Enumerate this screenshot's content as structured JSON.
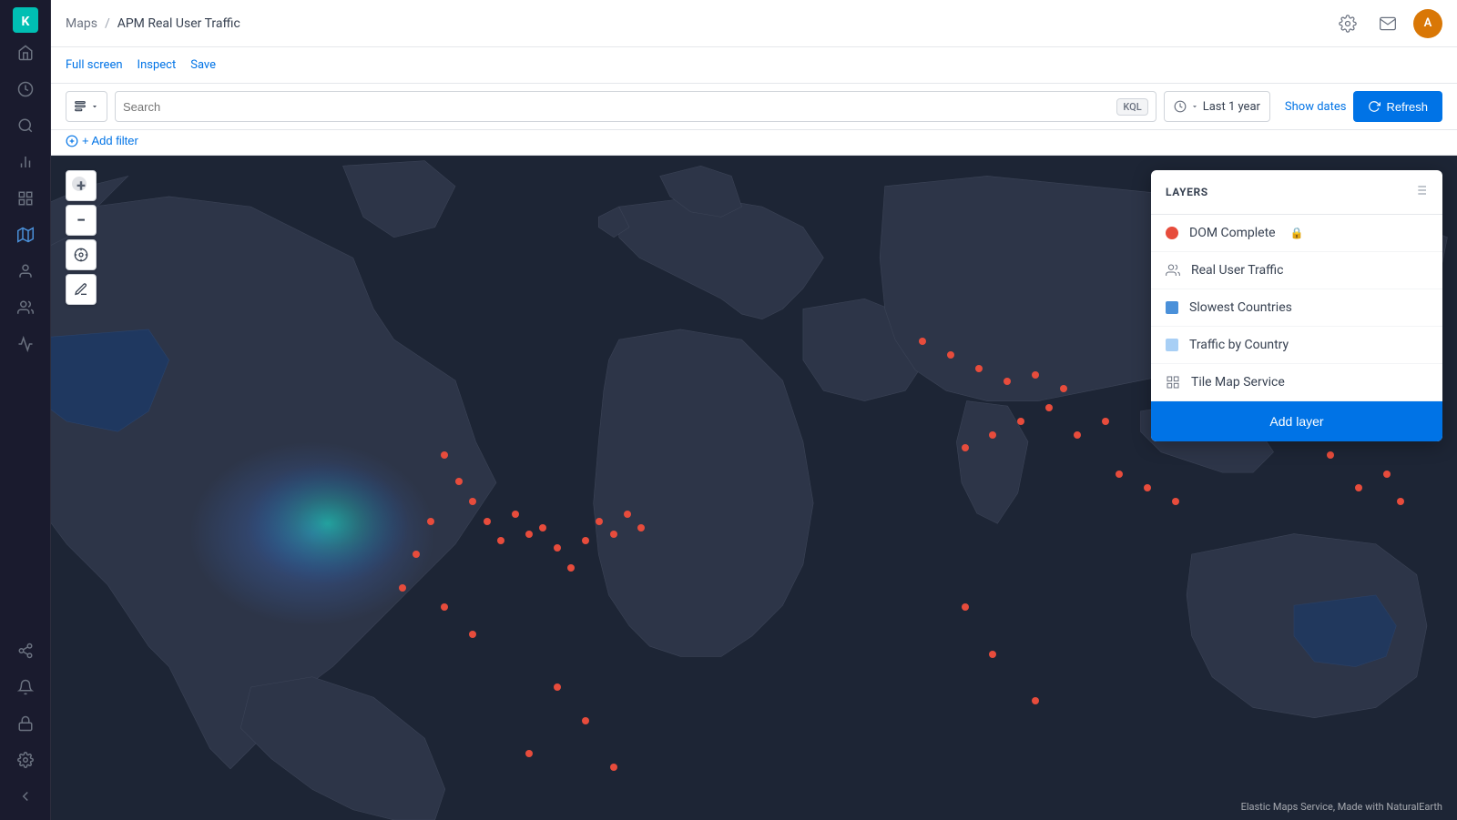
{
  "app": {
    "logo": "K",
    "breadcrumb": {
      "parent": "Maps",
      "separator": "/",
      "current": "APM Real User Traffic"
    }
  },
  "topbar": {
    "icons": {
      "settings": "⚙",
      "mail": "✉",
      "user_initial": "A"
    }
  },
  "actionbar": {
    "fullscreen_label": "Full screen",
    "inspect_label": "Inspect",
    "save_label": "Save"
  },
  "searchbar": {
    "search_type_icon": "☰",
    "search_placeholder": "Search",
    "kql_label": "KQL",
    "time_icon": "🕐",
    "time_range": "Last 1 year",
    "show_dates_label": "Show dates",
    "refresh_label": "Refresh"
  },
  "filterbar": {
    "filter_icon": "◎",
    "add_filter_label": "+ Add filter"
  },
  "layers_panel": {
    "title": "LAYERS",
    "menu_icon": "≡",
    "items": [
      {
        "name": "DOM Complete",
        "type": "dot",
        "color": "#e74c3c",
        "has_lock": true
      },
      {
        "name": "Real User Traffic",
        "type": "users",
        "color": null
      },
      {
        "name": "Slowest Countries",
        "type": "square",
        "color": "#4a90d9"
      },
      {
        "name": "Traffic by Country",
        "type": "square",
        "color": "#7ab8f5"
      },
      {
        "name": "Tile Map Service",
        "type": "grid",
        "color": null
      }
    ],
    "add_layer_label": "Add layer"
  },
  "map": {
    "controls": {
      "zoom_in": "+",
      "zoom_out": "−",
      "locate": "⊕",
      "select": "✎"
    },
    "attribution": "Elastic Maps Service, Made with NaturalEarth"
  },
  "sidebar": {
    "items": [
      {
        "icon": "🏠",
        "name": "home"
      },
      {
        "icon": "⏱",
        "name": "recently-viewed"
      },
      {
        "icon": "🔍",
        "name": "discover"
      },
      {
        "icon": "📊",
        "name": "visualize"
      },
      {
        "icon": "📋",
        "name": "dashboard"
      },
      {
        "icon": "🗺",
        "name": "maps",
        "active": true
      },
      {
        "icon": "👤",
        "name": "ml"
      },
      {
        "icon": "👥",
        "name": "security"
      },
      {
        "icon": "📈",
        "name": "apm"
      },
      {
        "icon": "⚙",
        "name": "settings"
      }
    ]
  }
}
